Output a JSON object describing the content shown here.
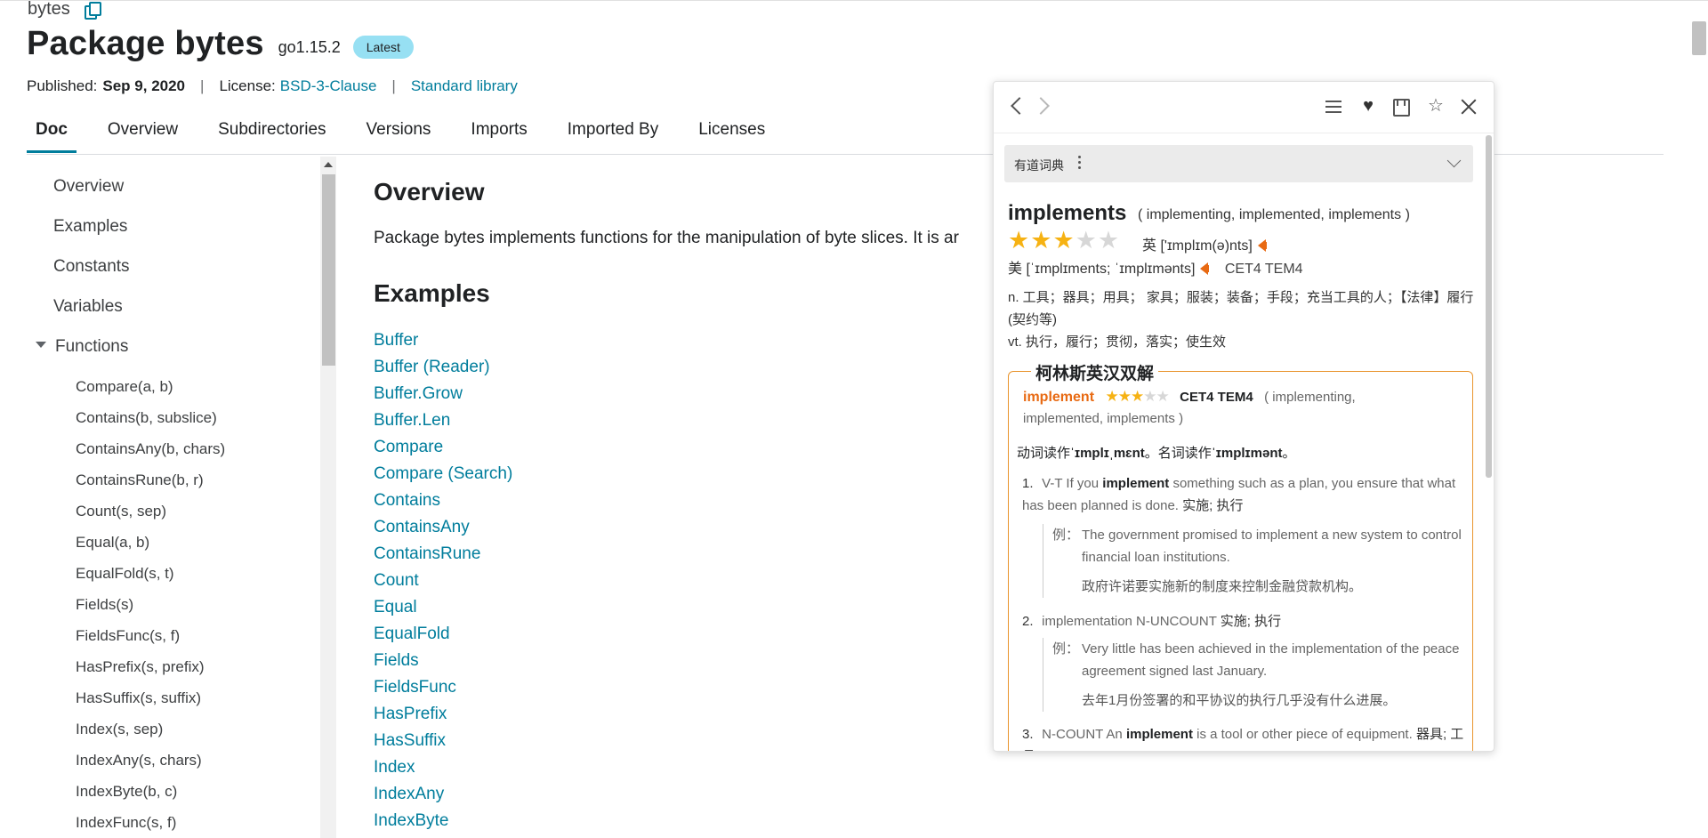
{
  "header": {
    "breadcrumb": "bytes",
    "title": "Package bytes",
    "version": "go1.15.2",
    "badge": "Latest",
    "published_label": "Published:",
    "published_date": "Sep 9, 2020",
    "license_label": "License:",
    "license_value": "BSD-3-Clause",
    "stdlib_link": "Standard library",
    "separator": "|"
  },
  "tabs": [
    {
      "label": "Doc",
      "active": true
    },
    {
      "label": "Overview"
    },
    {
      "label": "Subdirectories"
    },
    {
      "label": "Versions"
    },
    {
      "label": "Imports"
    },
    {
      "label": "Imported By"
    },
    {
      "label": "Licenses"
    }
  ],
  "sidebar": {
    "items": [
      "Overview",
      "Examples",
      "Constants",
      "Variables"
    ],
    "functions_label": "Functions",
    "functions": [
      "Compare(a, b)",
      "Contains(b, subslice)",
      "ContainsAny(b, chars)",
      "ContainsRune(b, r)",
      "Count(s, sep)",
      "Equal(a, b)",
      "EqualFold(s, t)",
      "Fields(s)",
      "FieldsFunc(s, f)",
      "HasPrefix(s, prefix)",
      "HasSuffix(s, suffix)",
      "Index(s, sep)",
      "IndexAny(s, chars)",
      "IndexByte(b, c)",
      "IndexFunc(s, f)"
    ]
  },
  "main": {
    "overview_heading": "Overview",
    "overview_text": "Package bytes implements functions for the manipulation of byte slices. It is ar",
    "examples_heading": "Examples",
    "examples": [
      "Buffer",
      "Buffer (Reader)",
      "Buffer.Grow",
      "Buffer.Len",
      "Compare",
      "Compare (Search)",
      "Contains",
      "ContainsAny",
      "ContainsRune",
      "Count",
      "Equal",
      "EqualFold",
      "Fields",
      "FieldsFunc",
      "HasPrefix",
      "HasSuffix",
      "Index",
      "IndexAny",
      "IndexByte"
    ]
  },
  "dictionary": {
    "toolbar_icons": [
      "back-icon",
      "forward-icon",
      "menu-icon",
      "heart-icon",
      "book-icon",
      "pin-icon",
      "close-icon"
    ],
    "source": "有道词典",
    "word": "implements",
    "inflections": "( implementing, implemented, implements )",
    "rating": 3,
    "rating_max": 5,
    "uk_label": "英",
    "uk_phonetic": "['ɪmplɪm(ə)nts]",
    "us_label": "美",
    "us_phonetic": "[ˈɪmplɪments; ˈɪmplɪmənts]",
    "levels": "CET4 TEM4",
    "def_n": "n. 工具；器具；用具； 家具；服装；装备；手段；充当工具的人；【法律】履行(契约等)",
    "def_vt": "vt. 执行，履行；贯彻，落实；使生效",
    "collins": {
      "title": "柯林斯英汉双解",
      "headword": "implement",
      "rating": 3,
      "rating_max": 5,
      "levels": "CET4 TEM4",
      "inflections_a": "( implementing,",
      "inflections_b": "implemented, implements )",
      "pron_a": "动词读作",
      "pron_b": "ˈɪmplɪˌmɛnt",
      "pron_c": "。名词读作",
      "pron_d": "ˈɪmplɪmənt",
      "pron_e": "。",
      "senses": [
        {
          "num": "1.",
          "pos": "V-T",
          "pre": "If you",
          "bold": "implement",
          "post": "something such as a plan, you ensure that what has been planned is done.",
          "cn": "实施; 执行",
          "example_label": "例：",
          "example": "The government promised to implement a new system to control financial loan institutions.",
          "example_cn": "政府许诺要实施新的制度来控制金融贷款机构。"
        },
        {
          "num": "2.",
          "pos": "implementation N-UNCOUNT",
          "cn": "实施; 执行",
          "example_label": "例：",
          "example": "Very little has been achieved in the implementation of the peace agreement signed last January.",
          "example_cn": "去年1月份签署的和平协议的执行几乎没有什么进展。"
        },
        {
          "num": "3.",
          "pos": "N-COUNT",
          "pre": "An",
          "bold": "implement",
          "post": "is a tool or other piece of equipment.",
          "cn": "器具; 工具"
        }
      ]
    }
  }
}
